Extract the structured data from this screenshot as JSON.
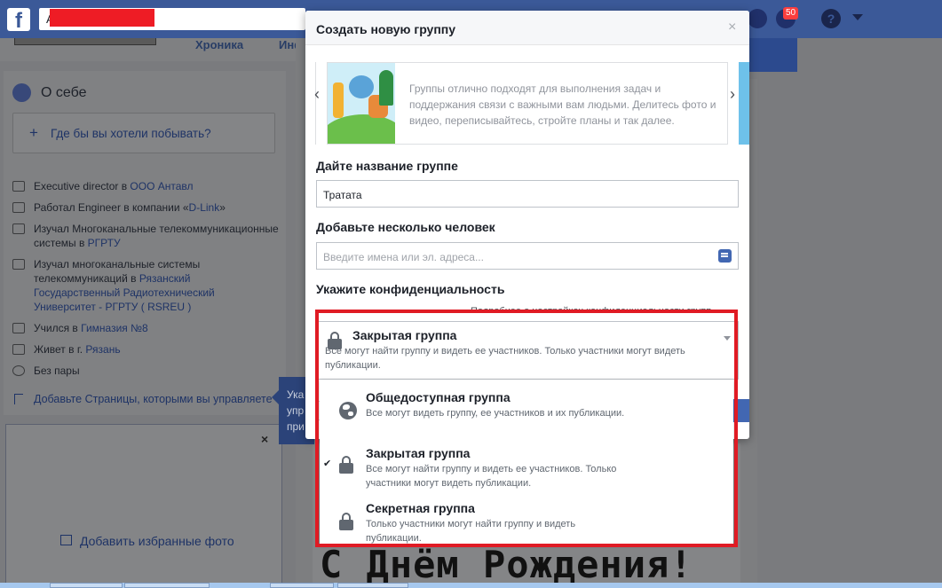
{
  "topbar": {
    "search_value": "А",
    "notifications_count": "50",
    "help_label": "?"
  },
  "profile": {
    "tabs": {
      "chronicle": "Хроника",
      "info": "Инф"
    },
    "about": {
      "title": "О себе",
      "wish_prompt": "Где бы вы хотели побывать?",
      "items": [
        {
          "text": "Executive director в ",
          "link": "ООО Антавл"
        },
        {
          "text": "Работал Engineer в компании «",
          "link": "D-Link",
          "suffix": "»"
        },
        {
          "text": "Изучал Многоканальные телекоммуникационные системы в ",
          "link": "РГРТУ"
        },
        {
          "text": "Изучал многоканальные системы телекоммуникаций в ",
          "link": "Рязанский Государственный Радиотехнический Университет - РГРТУ ( RSREU )"
        },
        {
          "text": "Учился в ",
          "link": "Гимназия №8"
        },
        {
          "text": "Живет в г. ",
          "link": "Рязань"
        },
        {
          "text": "Без пары",
          "link": ""
        }
      ],
      "add_pages": "Добавьте Страницы, которыми вы управляете"
    },
    "photos": {
      "add_label": "Добавить избранные фото"
    },
    "tooltip": "Ука\nупр\nпри",
    "birthday_text": "С Днём Рождения!"
  },
  "modal": {
    "title": "Создать новую группу",
    "close": "×",
    "carousel": {
      "prev": "‹",
      "next": "›",
      "text": "Группы отлично подходят для выполнения задач и поддержания связи с важными вам людьми. Делитесь фото и видео, переписывайтесь, стройте планы и так далее."
    },
    "name_label": "Дайте название группе",
    "name_value": "Тратата",
    "people_label": "Добавьте несколько человек",
    "people_placeholder": "Введите имена или эл. адреса...",
    "privacy_label": "Укажите конфиденциальность",
    "privacy_hint": "Подробнее о настройках конфиденциальности групп",
    "privacy_selected": {
      "title": "Закрытая группа",
      "desc": "Все могут найти группу и видеть ее участников. Только участники могут видеть публикации."
    },
    "privacy_options": [
      {
        "title": "Общедоступная группа",
        "desc": "Все могут видеть группу, ее участников и их публикации.",
        "icon": "globe-icon",
        "selected": false
      },
      {
        "title": "Закрытая группа",
        "desc": "Все могут найти группу и видеть ее участников. Только участники могут видеть публикации.",
        "icon": "lock-icon",
        "selected": true
      },
      {
        "title": "Секретная группа",
        "desc": "Только участники могут найти группу и видеть публикации.",
        "icon": "lock-icon",
        "selected": false
      }
    ],
    "check_mark": "✔"
  },
  "colors": {
    "facebook_blue": "#3b5998",
    "highlight_red": "#e01b24",
    "redaction_red": "#ee1c25"
  }
}
